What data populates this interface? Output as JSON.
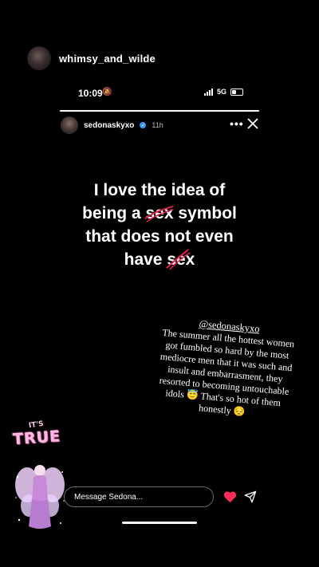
{
  "outer": {
    "username": "whimsy_and_wilde"
  },
  "status_bar": {
    "time": "10:09",
    "network": "5G"
  },
  "story": {
    "progress": 1.0,
    "username": "sedonaskyxo",
    "time": "11h",
    "more": "•••"
  },
  "quote": {
    "line1": "I love the idea of",
    "line2_pre": "being a ",
    "line2_strike": "sex",
    "line2_post": " symbol",
    "line3": "that does not even",
    "line4_pre": "have ",
    "line4_strike": "sex"
  },
  "caption": {
    "mention": "@sedonaskyxo",
    "body": "The summer all the hottest women got fumbled so hard by the most mediocre men that it was such and insult and embarrasment, they resorted to becoming untouchable idols 😇 That's so hot of them honestly 😔"
  },
  "sticker": {
    "its": "IT'S",
    "true": "TRUE"
  },
  "message": {
    "placeholder": "Message Sedona..."
  },
  "colors": {
    "heart": "#ff2d55",
    "strike": "#e0204a",
    "sticker_pink": "#ffb9e4"
  }
}
